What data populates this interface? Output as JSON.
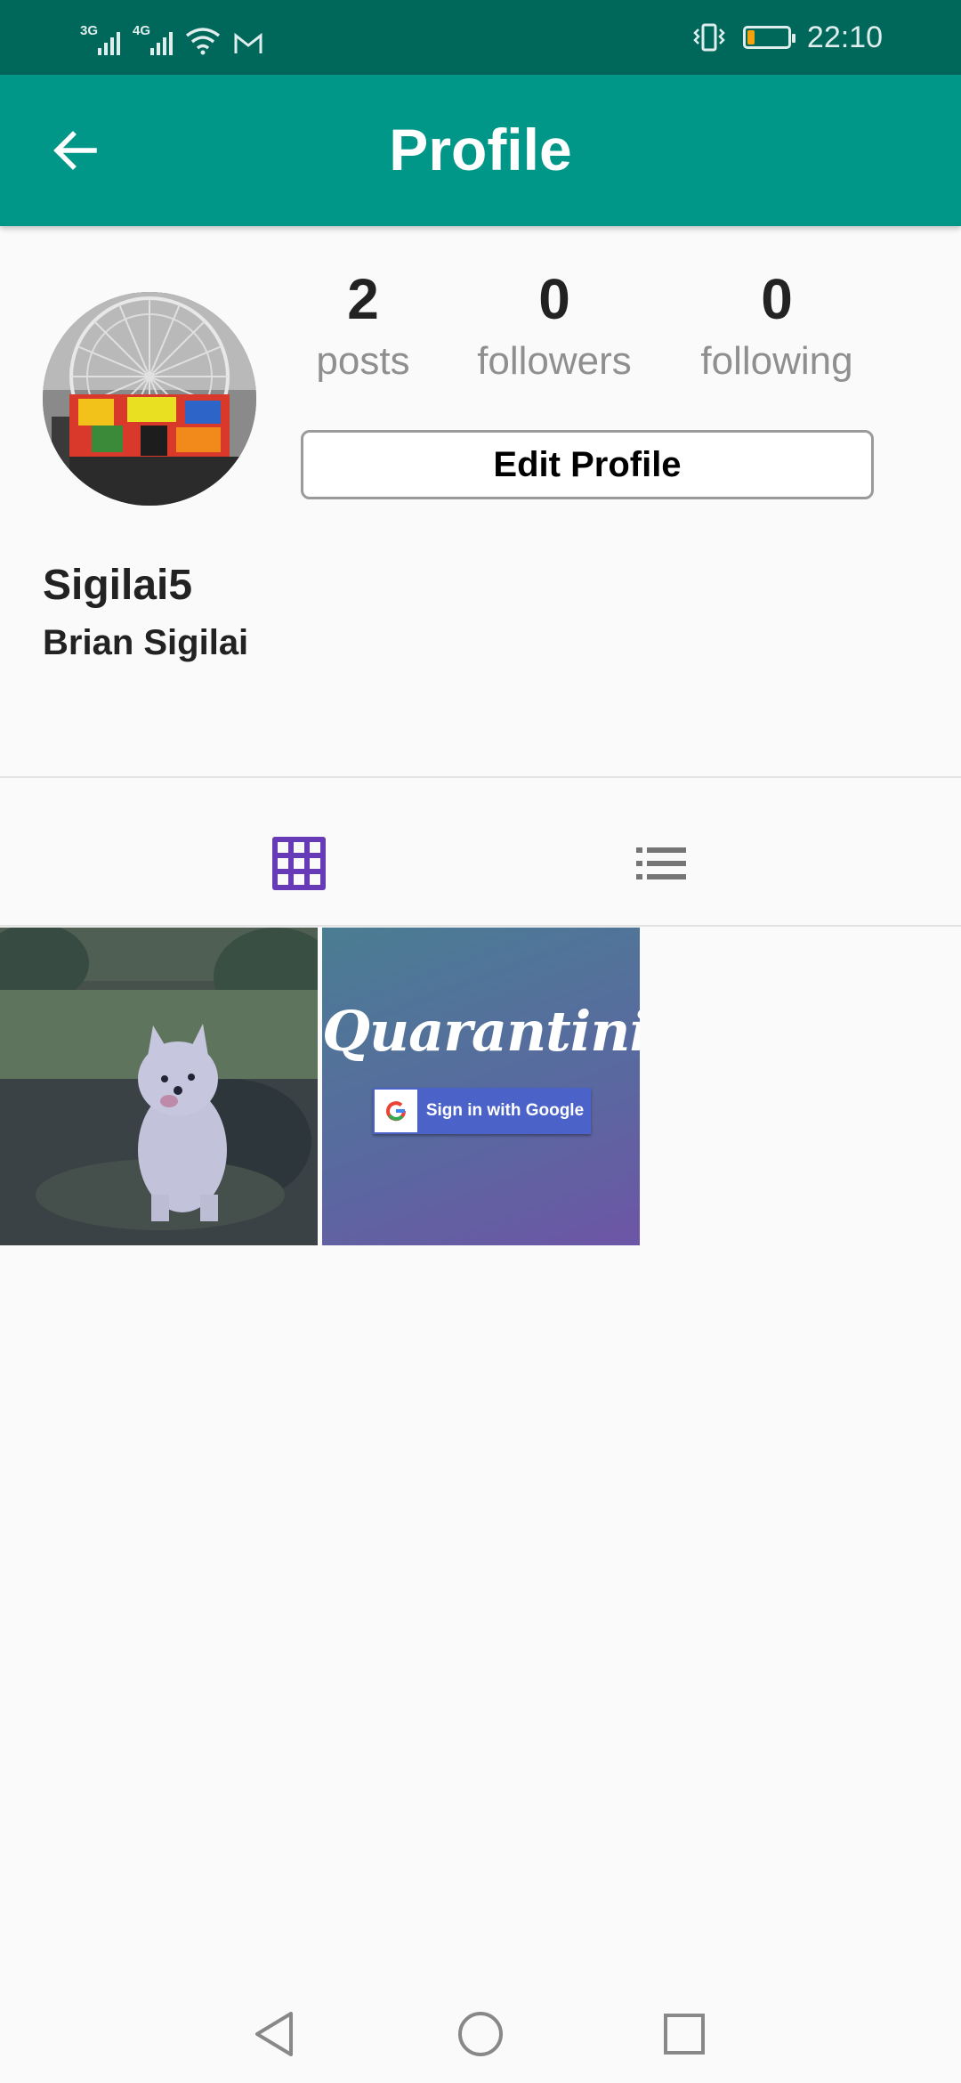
{
  "status_bar": {
    "network_1": "3G",
    "network_2": "4G",
    "time": "22:10",
    "battery_level": 0.18,
    "icons": [
      "signal-icon",
      "signal-icon",
      "wifi-icon",
      "gmail-icon",
      "vibrate-icon",
      "battery-icon"
    ]
  },
  "app_bar": {
    "title": "Profile",
    "back_icon": "arrow-back-icon"
  },
  "profile": {
    "stats": [
      {
        "value": "2",
        "label": "posts"
      },
      {
        "value": "0",
        "label": "followers"
      },
      {
        "value": "0",
        "label": "following"
      }
    ],
    "edit_button_label": "Edit Profile",
    "username": "Sigilai5",
    "full_name": "Brian Sigilai"
  },
  "tabs": {
    "grid_icon": "grid-icon",
    "list_icon": "list-icon",
    "active": "grid"
  },
  "posts": {
    "post_2": {
      "title": "Quarantini",
      "google_button_label": "Sign in with Google"
    }
  },
  "colors": {
    "status_bar": "#00675b",
    "app_bar": "#009688",
    "active_tab": "#673ab7",
    "inactive_tab": "#757575"
  },
  "nav_bar": {
    "icons": [
      "back-triangle-icon",
      "home-circle-icon",
      "recents-square-icon"
    ]
  }
}
